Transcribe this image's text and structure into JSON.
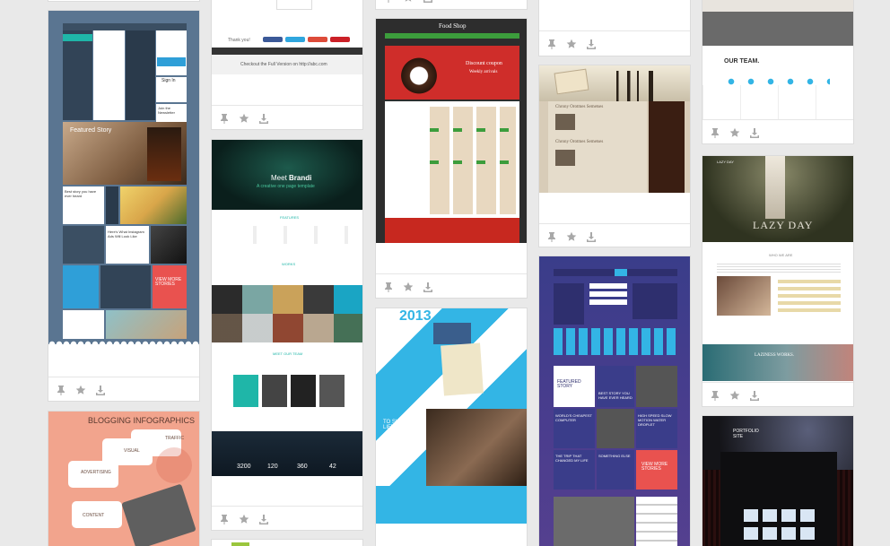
{
  "colors": {
    "page_bg": "#e9e9e9",
    "icon": "#a8a8a8",
    "flat_blue": "#2f9fd8",
    "flat_teal": "#1fb6a8",
    "flat_red": "#e9524f",
    "purple": "#4b3d8e",
    "cyan": "#33b5e5"
  },
  "icons": [
    "pin-icon",
    "star-icon",
    "download-icon"
  ],
  "cards": [
    {
      "id": "flat-ui-kit",
      "texts": {
        "featured": "Featured Story",
        "sign": "Sign In",
        "news": "Join the Newsletter",
        "view_more": "VIEW MORE STORIES",
        "insta": "Here's What Instagram Ads Will Look Like",
        "best": "Best story you have ever heard"
      }
    },
    {
      "id": "blogging-infographics",
      "texts": {
        "title": "BLOGGING INFOGRAPHICS",
        "traffic": "TRAFFIC",
        "visual": "VISUAL",
        "advertising": "ADVERTISING",
        "content": "CONTENT"
      }
    },
    {
      "id": "share-bar",
      "texts": {
        "thank": "Thank you!",
        "checkout": "Checkout the Full Version on http://abc.com"
      }
    },
    {
      "id": "brandi-template",
      "texts": {
        "headline_1": "Meet",
        "headline_2": "Brandi",
        "sub": "A creative one page template",
        "features": "FEATURES",
        "works": "WORKS",
        "team": "MEET OUR TEAM",
        "stats": [
          "3200",
          "120",
          "360",
          "42"
        ]
      }
    },
    {
      "id": "food-shop",
      "texts": {
        "logo": "Food Shop",
        "promo_1": "Discount coupon",
        "promo_2": "Weekly arrivals"
      }
    },
    {
      "id": "share-my-life",
      "texts": {
        "year": "2013",
        "headline": "TO SHARE MY LIFE"
      }
    },
    {
      "id": "grunge-city",
      "texts": {
        "headline_1": "Chrony Orotmes Semetses",
        "headline_2": "Chrony Orotmes Semetses"
      }
    },
    {
      "id": "metro-ui-kit",
      "texts": {
        "featured": "FEATURED STORY",
        "best": "BEST STORY YOU HAVE EVER HEARD",
        "cheapest": "WORLD'S CHEAPEST COMPUTER",
        "motion": "HIGH SPEED SLOW MOTION WATER DROPLET",
        "trip": "THE TRIP THAT CHANGED MY LIFE",
        "else": "SOMETHING ELSE",
        "view_more": "VIEW MORE STORIES"
      }
    },
    {
      "id": "our-team",
      "texts": {
        "title": "OUR TEAM."
      }
    },
    {
      "id": "lazy-day",
      "texts": {
        "logo": "LAZY DAY",
        "hero": "LAZY DAY",
        "about": "WHO WE ARE",
        "works": "LAZINESS WORKS."
      }
    },
    {
      "id": "portfolio-site",
      "texts": {
        "title": "PORTFOLIO SITE"
      }
    }
  ]
}
